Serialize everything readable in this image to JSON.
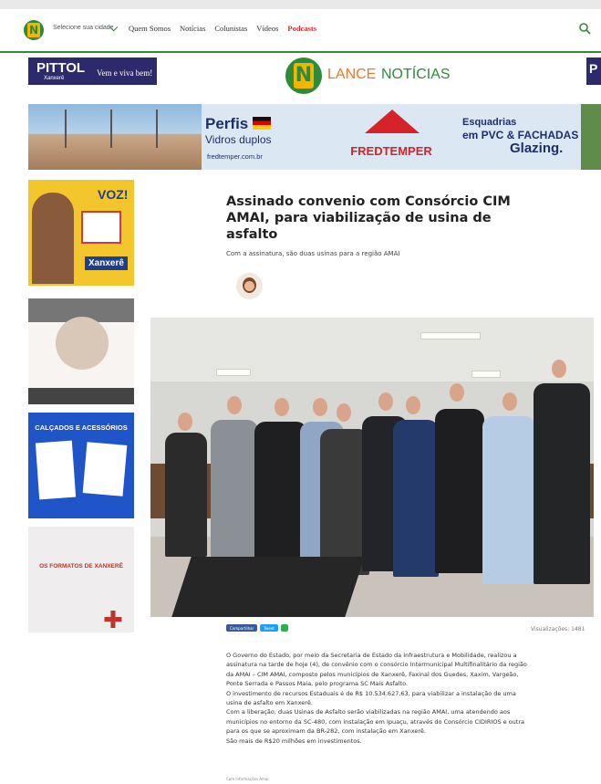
{
  "nav": {
    "city_label": "Selecione sua cidade",
    "items": [
      "Quem Somos",
      "Notícias",
      "Colunistas",
      "Vídeos",
      "Podcasts"
    ]
  },
  "ads": {
    "pittol": {
      "name": "PITTOL",
      "city": "Xanxerê",
      "tagline": "Vem e viva bem!"
    },
    "pittol_right": "P",
    "banner": {
      "perfis": "Perfis",
      "vidros": "Vidros duplos",
      "site": "fredtemper.com.br",
      "fred": "FREDTEMPER",
      "esq1": "Esquadrias",
      "esq2": "em PVC & FACHADAS",
      "glazing": "Glazing."
    },
    "side1": {
      "voz": "VOZ!",
      "city": "Xanxerê"
    },
    "side3": {
      "title": "CALÇADOS E ACESSÓRIOS"
    },
    "side4": {
      "title": "OS FORMATOS DE XANXERÊ"
    }
  },
  "brand": {
    "lance": "LANCE",
    "noticias": "NOTÍCIAS"
  },
  "article": {
    "title": "Assinado convenio com Consórcio CIM AMAI, para viabilização de usina de asfalto",
    "subtitle": "Com a assinatura, são duas usinas para a região AMAI",
    "views": "Visualizações: 1481",
    "share": [
      "Compartilhar",
      "Tweet"
    ],
    "paragraphs": [
      "O Governo do Estado, por meio da Secretaria de Estado da Infraestrutura e Mobilidade, realizou a assinatura na tarde de hoje (4), de convênio com o consórcio Intermunicipal Multifinalitário da região da AMAI – CIM AMAI, composto pelos municípios de Xanxerê, Faxinal dos Guedes, Xaxim, Vargeão, Ponte Serrada e Passos Maia, pelo programa SC Mais Asfalto.",
      "O investimento de recursos Estaduais é de R$ 10.534.627,63, para viabilizar a instalação de uma usina de asfalto em Xanxerê.",
      "Com a liberação, duas Usinas de Asfalto serão viabilizadas na região AMAI, uma atendendo aos municípios no entorno da SC-480, com instalação em Ipuaçu, através do Consórcio CIDIRIOS e outra para os que se aproximam da BR-282, com instalação em Xanxerê.",
      "São mais de R$20 milhões em investimentos."
    ],
    "credit": "Com informações Amai"
  },
  "colors": {
    "green": "#2e8b3a",
    "orange": "#e8772a",
    "red": "#d9262a",
    "navy": "#2c2a6d"
  }
}
